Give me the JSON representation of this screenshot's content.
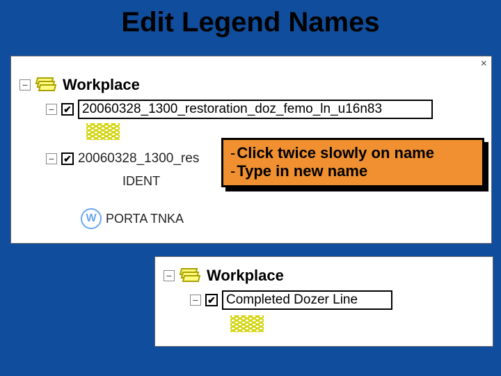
{
  "title": "Edit Legend Names",
  "panel1": {
    "workplace_label": "Workplace",
    "layer1_name": "20060328_1300_restoration_doz_femo_ln_u16n83",
    "layer2_name_partial": "20060328_1300_res",
    "ident_label": "IDENT",
    "porta_label": "PORTA TNKA"
  },
  "panel2": {
    "workplace_label": "Workplace",
    "layer_renamed": "Completed Dozer Line"
  },
  "callout": {
    "line1_strong": "Click twice slowly on name",
    "line2_strong": "Type in new name"
  },
  "glyphs": {
    "minus": "−",
    "check": "✔",
    "close": "×",
    "dash": "-",
    "w": "W"
  }
}
